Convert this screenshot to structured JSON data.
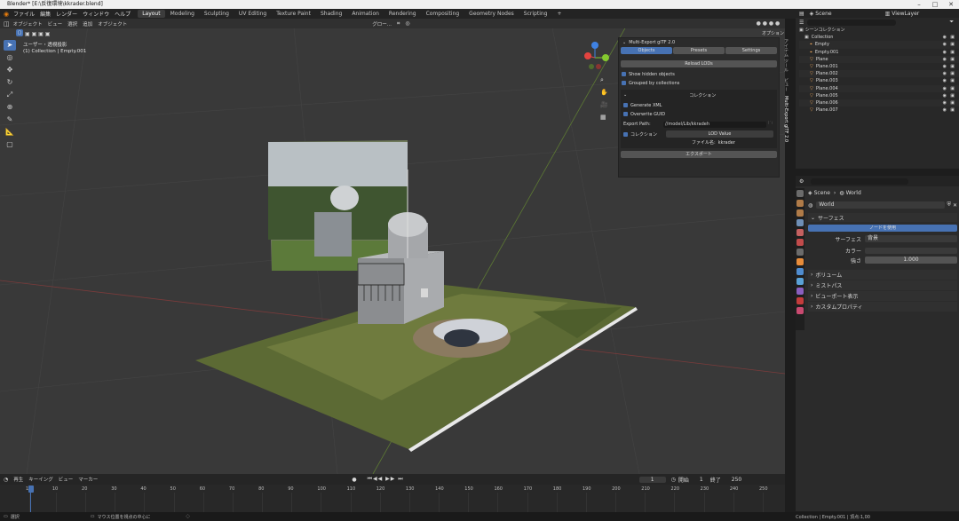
{
  "titlebar": {
    "title": "Blender* [E:\\反復環境\\kkrader.blend]"
  },
  "menu": {
    "items": [
      "ファイル",
      "編集",
      "レンダー",
      "ウィンドウ",
      "ヘルプ"
    ],
    "workspaces": [
      "Layout",
      "Modeling",
      "Sculpting",
      "UV Editing",
      "Texture Paint",
      "Shading",
      "Animation",
      "Rendering",
      "Compositing",
      "Geometry Nodes",
      "Scripting",
      "+"
    ],
    "scene_label": "Scene",
    "view_layer_label": "ViewLayer"
  },
  "viewport": {
    "mode": "オブジェクト",
    "header_menus": [
      "ビュー",
      "選択",
      "追加",
      "オブジェクト"
    ],
    "transform": "グロー...",
    "view_name": "ユーザー・透視投影",
    "collection_info": "(1) Collection | Empty.001",
    "options_label": "オプション ▾",
    "nav_axes": {
      "x": "X",
      "y": "Y",
      "z": "Z"
    },
    "colors": {
      "accent": "#4772b3",
      "x_axis": "#e3433f",
      "y_axis": "#84c82f",
      "z_axis": "#3f82e3"
    }
  },
  "npanel": {
    "title": "Multi-Export glTF 2.0",
    "tabs": [
      "Objects",
      "Presets",
      "Settings"
    ],
    "active_tab": "Objects",
    "reload_button": "Reload LODs",
    "show_hidden": "Show hidden objects",
    "grouped": "Grouped by collections",
    "collection_header": "コレクション",
    "generate_xml": "Generate XML",
    "overwrite_guid": "Overwrite GUID",
    "export_path_label": "Export Path:",
    "export_path_value": "//model/Lib/kkradeh",
    "collection_label": "コレクション",
    "lod_value": "LOD Value",
    "filename_label": "ファイル名:",
    "filename_value": "kkrader",
    "export_button": "エクスポート",
    "side_tabs": [
      "アイテム",
      "ツール",
      "ビュー",
      "Multi-Export glTF 2.0"
    ]
  },
  "outliner": {
    "header": "シーンコレクション",
    "items": [
      {
        "name": "Collection",
        "indent": 1,
        "kind": "collection"
      },
      {
        "name": "Empty",
        "indent": 2,
        "kind": "empty"
      },
      {
        "name": "Empty.001",
        "indent": 2,
        "kind": "empty"
      },
      {
        "name": "Plane",
        "indent": 2,
        "kind": "mesh"
      },
      {
        "name": "Plane.001",
        "indent": 2,
        "kind": "mesh"
      },
      {
        "name": "Plane.002",
        "indent": 2,
        "kind": "mesh"
      },
      {
        "name": "Plane.003",
        "indent": 2,
        "kind": "mesh"
      },
      {
        "name": "Plane.004",
        "indent": 2,
        "kind": "mesh"
      },
      {
        "name": "Plane.005",
        "indent": 2,
        "kind": "mesh"
      },
      {
        "name": "Plane.006",
        "indent": 2,
        "kind": "mesh"
      },
      {
        "name": "Plane.007",
        "indent": 2,
        "kind": "mesh"
      }
    ]
  },
  "properties": {
    "breadcrumb_scene": "Scene",
    "breadcrumb_world": "World",
    "world_name": "World",
    "surface_header": "サーフェス",
    "use_nodes_button": "ノードを使用",
    "surface_label": "サーフェス",
    "surface_value": "背景",
    "color_label": "カラー",
    "strength_label": "強さ",
    "strength_value": "1.000",
    "sections": [
      "ボリューム",
      "ミストパス",
      "ビューポート表示",
      "カスタムプロパティ"
    ]
  },
  "timeline": {
    "menus": [
      "再生",
      "キーイング",
      "ビュー",
      "マーカー"
    ],
    "current_frame": "1",
    "start_label": "開始",
    "start_value": "1",
    "end_label": "終了",
    "end_value": "250",
    "ticks": [
      "1",
      "10",
      "20",
      "30",
      "40",
      "50",
      "60",
      "70",
      "80",
      "90",
      "100",
      "110",
      "120",
      "130",
      "140",
      "150",
      "160",
      "170",
      "180",
      "190",
      "200",
      "210",
      "220",
      "230",
      "240",
      "250"
    ]
  },
  "statusbar": {
    "left": "選択",
    "middle": "マウス位置を視点の中心に",
    "right": "Collection | Empty.001 | 頂点:1,00"
  }
}
